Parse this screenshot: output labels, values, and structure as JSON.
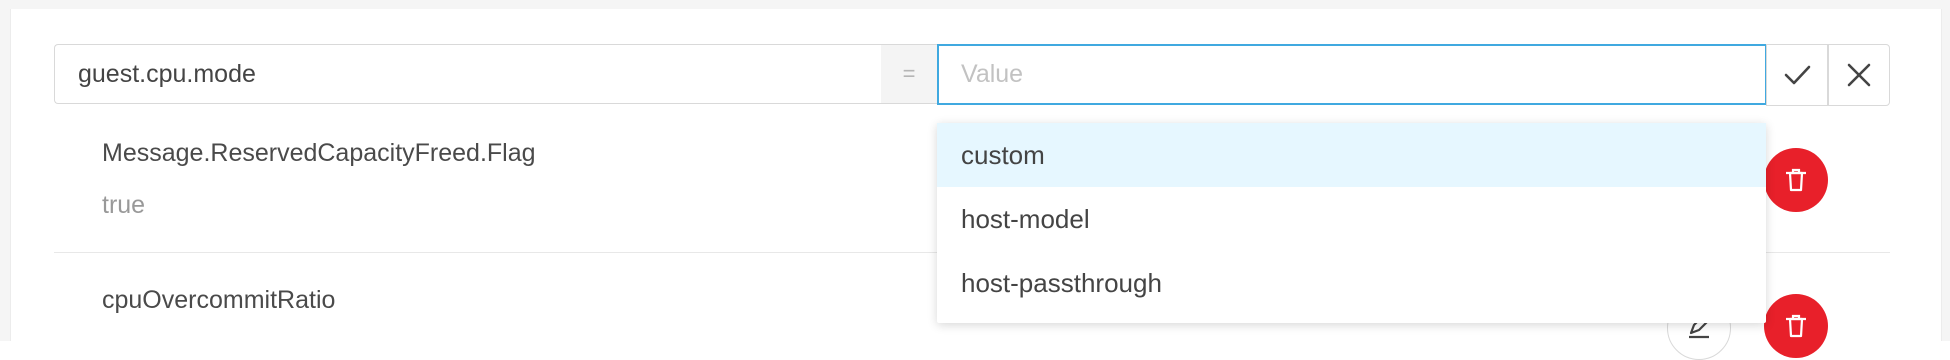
{
  "edit_row": {
    "key_value": "guest.cpu.mode",
    "separator": "=",
    "value_placeholder": "Value",
    "value_value": ""
  },
  "dropdown": {
    "options": [
      "custom",
      "host-model",
      "host-passthrough"
    ],
    "highlighted_index": 0
  },
  "items": [
    {
      "key": "Message.ReservedCapacityFreed.Flag",
      "value": "true"
    },
    {
      "key": "cpuOvercommitRatio",
      "value": ""
    }
  ],
  "icons": {
    "confirm": "check-icon",
    "cancel": "close-icon",
    "delete": "trash-icon",
    "edit": "edit-icon"
  },
  "colors": {
    "accent_border": "#40a9e0",
    "delete_red": "#e8202a",
    "highlight_bg": "#e6f7ff"
  }
}
